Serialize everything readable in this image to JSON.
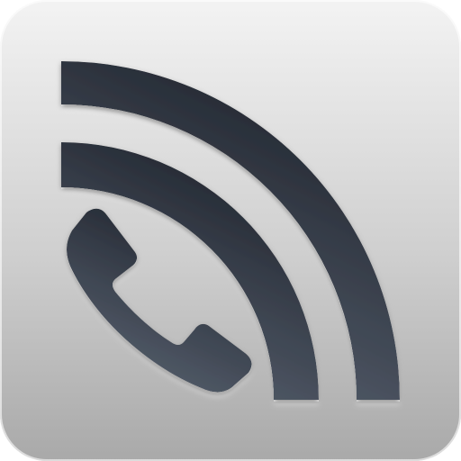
{
  "icon": {
    "name": "phone-signal-app-icon",
    "glyphs": [
      "phone-handset-icon",
      "signal-wave-icon"
    ],
    "colors": {
      "tile_top": "#f3f3f3",
      "tile_bottom": "#a9a9a9",
      "glyph_light": "#5b6573",
      "glyph_dark": "#1c2029",
      "bevel_highlight": "#ffffff"
    }
  }
}
